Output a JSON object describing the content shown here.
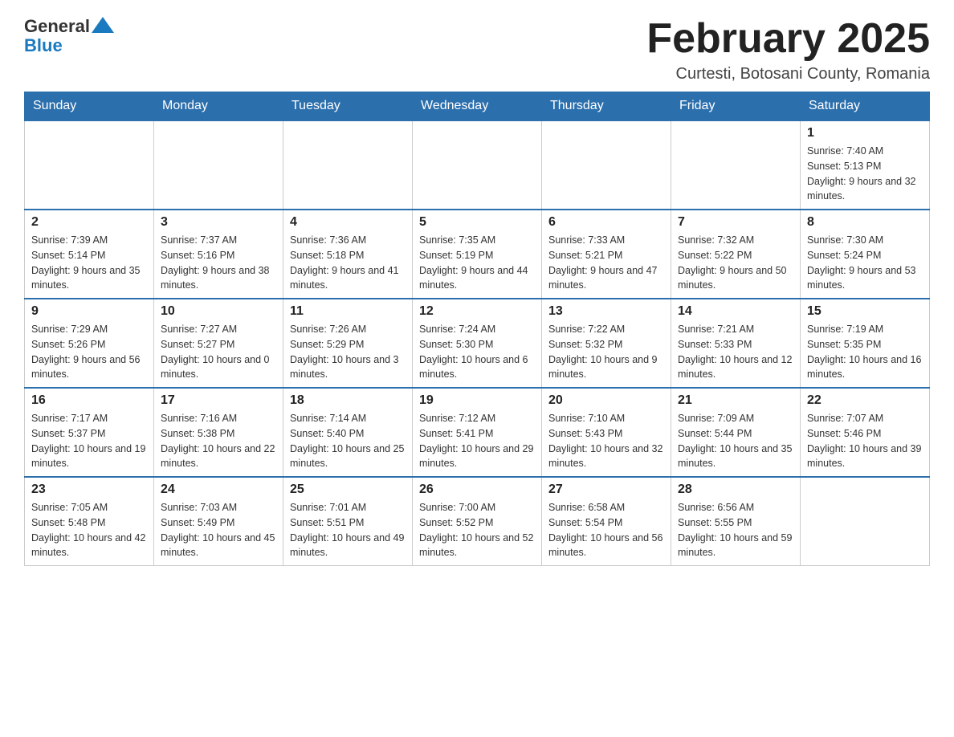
{
  "header": {
    "logo": {
      "general": "General",
      "blue": "Blue"
    },
    "title": "February 2025",
    "location": "Curtesti, Botosani County, Romania"
  },
  "days_of_week": [
    "Sunday",
    "Monday",
    "Tuesday",
    "Wednesday",
    "Thursday",
    "Friday",
    "Saturday"
  ],
  "weeks": [
    [
      {
        "day": "",
        "sunrise": "",
        "sunset": "",
        "daylight": ""
      },
      {
        "day": "",
        "sunrise": "",
        "sunset": "",
        "daylight": ""
      },
      {
        "day": "",
        "sunrise": "",
        "sunset": "",
        "daylight": ""
      },
      {
        "day": "",
        "sunrise": "",
        "sunset": "",
        "daylight": ""
      },
      {
        "day": "",
        "sunrise": "",
        "sunset": "",
        "daylight": ""
      },
      {
        "day": "",
        "sunrise": "",
        "sunset": "",
        "daylight": ""
      },
      {
        "day": "1",
        "sunrise": "Sunrise: 7:40 AM",
        "sunset": "Sunset: 5:13 PM",
        "daylight": "Daylight: 9 hours and 32 minutes."
      }
    ],
    [
      {
        "day": "2",
        "sunrise": "Sunrise: 7:39 AM",
        "sunset": "Sunset: 5:14 PM",
        "daylight": "Daylight: 9 hours and 35 minutes."
      },
      {
        "day": "3",
        "sunrise": "Sunrise: 7:37 AM",
        "sunset": "Sunset: 5:16 PM",
        "daylight": "Daylight: 9 hours and 38 minutes."
      },
      {
        "day": "4",
        "sunrise": "Sunrise: 7:36 AM",
        "sunset": "Sunset: 5:18 PM",
        "daylight": "Daylight: 9 hours and 41 minutes."
      },
      {
        "day": "5",
        "sunrise": "Sunrise: 7:35 AM",
        "sunset": "Sunset: 5:19 PM",
        "daylight": "Daylight: 9 hours and 44 minutes."
      },
      {
        "day": "6",
        "sunrise": "Sunrise: 7:33 AM",
        "sunset": "Sunset: 5:21 PM",
        "daylight": "Daylight: 9 hours and 47 minutes."
      },
      {
        "day": "7",
        "sunrise": "Sunrise: 7:32 AM",
        "sunset": "Sunset: 5:22 PM",
        "daylight": "Daylight: 9 hours and 50 minutes."
      },
      {
        "day": "8",
        "sunrise": "Sunrise: 7:30 AM",
        "sunset": "Sunset: 5:24 PM",
        "daylight": "Daylight: 9 hours and 53 minutes."
      }
    ],
    [
      {
        "day": "9",
        "sunrise": "Sunrise: 7:29 AM",
        "sunset": "Sunset: 5:26 PM",
        "daylight": "Daylight: 9 hours and 56 minutes."
      },
      {
        "day": "10",
        "sunrise": "Sunrise: 7:27 AM",
        "sunset": "Sunset: 5:27 PM",
        "daylight": "Daylight: 10 hours and 0 minutes."
      },
      {
        "day": "11",
        "sunrise": "Sunrise: 7:26 AM",
        "sunset": "Sunset: 5:29 PM",
        "daylight": "Daylight: 10 hours and 3 minutes."
      },
      {
        "day": "12",
        "sunrise": "Sunrise: 7:24 AM",
        "sunset": "Sunset: 5:30 PM",
        "daylight": "Daylight: 10 hours and 6 minutes."
      },
      {
        "day": "13",
        "sunrise": "Sunrise: 7:22 AM",
        "sunset": "Sunset: 5:32 PM",
        "daylight": "Daylight: 10 hours and 9 minutes."
      },
      {
        "day": "14",
        "sunrise": "Sunrise: 7:21 AM",
        "sunset": "Sunset: 5:33 PM",
        "daylight": "Daylight: 10 hours and 12 minutes."
      },
      {
        "day": "15",
        "sunrise": "Sunrise: 7:19 AM",
        "sunset": "Sunset: 5:35 PM",
        "daylight": "Daylight: 10 hours and 16 minutes."
      }
    ],
    [
      {
        "day": "16",
        "sunrise": "Sunrise: 7:17 AM",
        "sunset": "Sunset: 5:37 PM",
        "daylight": "Daylight: 10 hours and 19 minutes."
      },
      {
        "day": "17",
        "sunrise": "Sunrise: 7:16 AM",
        "sunset": "Sunset: 5:38 PM",
        "daylight": "Daylight: 10 hours and 22 minutes."
      },
      {
        "day": "18",
        "sunrise": "Sunrise: 7:14 AM",
        "sunset": "Sunset: 5:40 PM",
        "daylight": "Daylight: 10 hours and 25 minutes."
      },
      {
        "day": "19",
        "sunrise": "Sunrise: 7:12 AM",
        "sunset": "Sunset: 5:41 PM",
        "daylight": "Daylight: 10 hours and 29 minutes."
      },
      {
        "day": "20",
        "sunrise": "Sunrise: 7:10 AM",
        "sunset": "Sunset: 5:43 PM",
        "daylight": "Daylight: 10 hours and 32 minutes."
      },
      {
        "day": "21",
        "sunrise": "Sunrise: 7:09 AM",
        "sunset": "Sunset: 5:44 PM",
        "daylight": "Daylight: 10 hours and 35 minutes."
      },
      {
        "day": "22",
        "sunrise": "Sunrise: 7:07 AM",
        "sunset": "Sunset: 5:46 PM",
        "daylight": "Daylight: 10 hours and 39 minutes."
      }
    ],
    [
      {
        "day": "23",
        "sunrise": "Sunrise: 7:05 AM",
        "sunset": "Sunset: 5:48 PM",
        "daylight": "Daylight: 10 hours and 42 minutes."
      },
      {
        "day": "24",
        "sunrise": "Sunrise: 7:03 AM",
        "sunset": "Sunset: 5:49 PM",
        "daylight": "Daylight: 10 hours and 45 minutes."
      },
      {
        "day": "25",
        "sunrise": "Sunrise: 7:01 AM",
        "sunset": "Sunset: 5:51 PM",
        "daylight": "Daylight: 10 hours and 49 minutes."
      },
      {
        "day": "26",
        "sunrise": "Sunrise: 7:00 AM",
        "sunset": "Sunset: 5:52 PM",
        "daylight": "Daylight: 10 hours and 52 minutes."
      },
      {
        "day": "27",
        "sunrise": "Sunrise: 6:58 AM",
        "sunset": "Sunset: 5:54 PM",
        "daylight": "Daylight: 10 hours and 56 minutes."
      },
      {
        "day": "28",
        "sunrise": "Sunrise: 6:56 AM",
        "sunset": "Sunset: 5:55 PM",
        "daylight": "Daylight: 10 hours and 59 minutes."
      },
      {
        "day": "",
        "sunrise": "",
        "sunset": "",
        "daylight": ""
      }
    ]
  ]
}
